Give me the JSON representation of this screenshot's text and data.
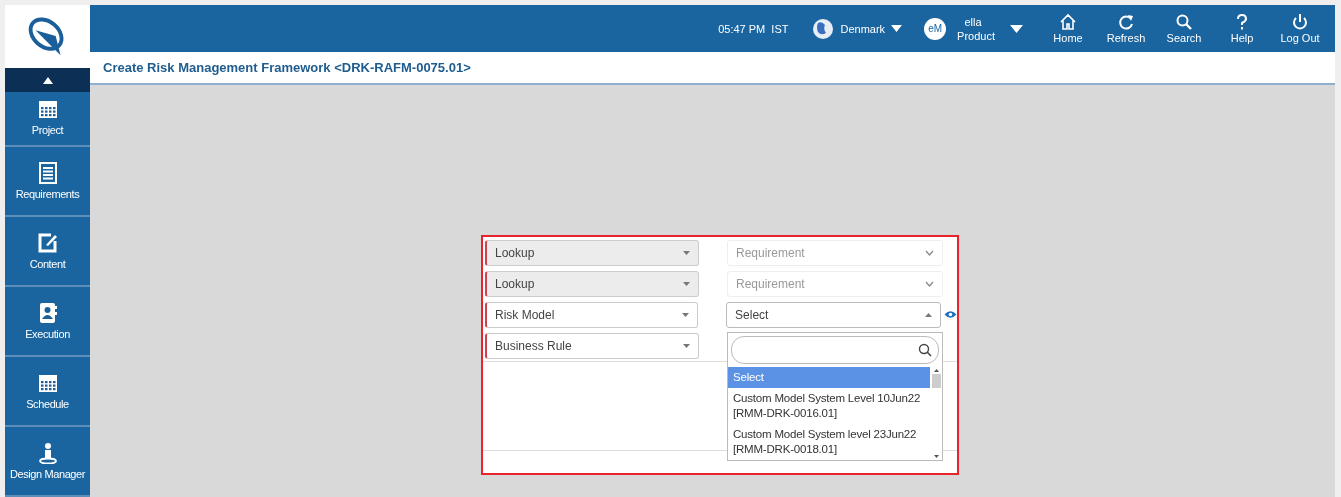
{
  "header": {
    "time": "05:47 PM",
    "timezone": "IST",
    "country": "Denmark",
    "user_initials": "eM",
    "user_name": "ella",
    "user_role": "Product",
    "nav": [
      {
        "kind": "home",
        "label": "Home"
      },
      {
        "kind": "refresh",
        "label": "Refresh"
      },
      {
        "kind": "search",
        "label": "Search"
      },
      {
        "kind": "help",
        "label": "Help"
      },
      {
        "kind": "logout",
        "label": "Log Out"
      }
    ]
  },
  "page_title": "Create Risk Management Framework <DRK-RAFM-0075.01>",
  "sidebar": {
    "items": [
      {
        "kind": "project",
        "label": "Project"
      },
      {
        "kind": "requirements",
        "label": "Requirements"
      },
      {
        "kind": "content",
        "label": "Content"
      },
      {
        "kind": "execution",
        "label": "Execution"
      },
      {
        "kind": "schedule",
        "label": "Schedule"
      },
      {
        "kind": "design",
        "label": "Design Manager"
      }
    ]
  },
  "form": {
    "rows": [
      {
        "left": {
          "value": "Lookup",
          "disabled": true
        },
        "right": {
          "value": "Requirement",
          "disabled": true,
          "open": false
        }
      },
      {
        "left": {
          "value": "Lookup",
          "disabled": true
        },
        "right": {
          "value": "Requirement",
          "disabled": true,
          "open": false
        }
      },
      {
        "left": {
          "value": "Risk Model",
          "disabled": false
        },
        "right": {
          "value": "Select",
          "disabled": false,
          "open": true
        }
      },
      {
        "left": {
          "value": "Business Rule",
          "disabled": false
        }
      }
    ],
    "dropdown": {
      "options": [
        {
          "label": "Select",
          "selected": true
        },
        {
          "label": "Custom Model System Level 10Jun22",
          "code": "[RMM-DRK-0016.01]",
          "selected": false
        },
        {
          "label": "Custom Model System level 23Jun22",
          "code": "[RMM-DRK-0018.01]",
          "selected": false
        }
      ]
    }
  }
}
